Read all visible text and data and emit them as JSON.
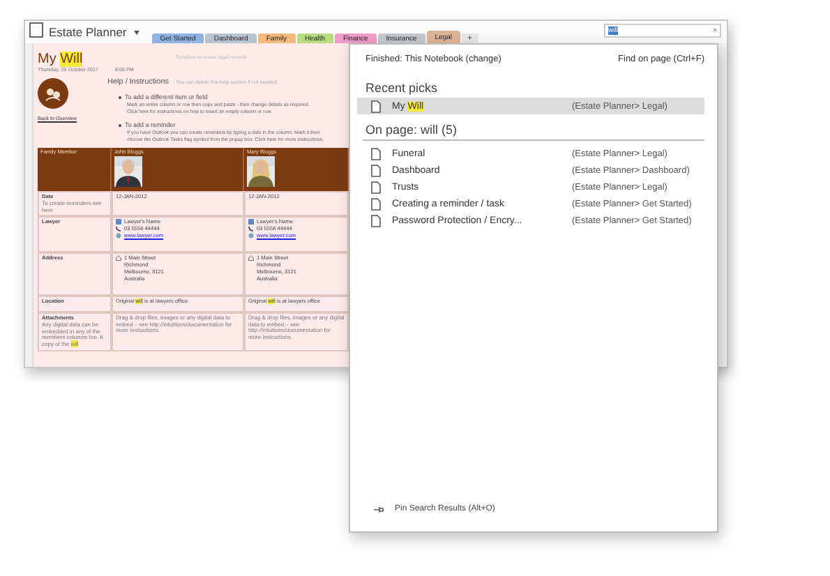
{
  "window": {
    "title": "Estate Planner",
    "tabs": [
      {
        "label": "Get Started",
        "color": "#8fb4e3",
        "selected": false
      },
      {
        "label": "Dashboard",
        "color": "#b8c4d0",
        "selected": false
      },
      {
        "label": "Family",
        "color": "#f5b979",
        "selected": false
      },
      {
        "label": "Health",
        "color": "#b5dc7e",
        "selected": false
      },
      {
        "label": "Finance",
        "color": "#f29ac8",
        "selected": false
      },
      {
        "label": "Insurance",
        "color": "#c3c8ce",
        "selected": false
      },
      {
        "label": "Legal",
        "color": "#dcb49a",
        "selected": true
      }
    ],
    "add_tab": "+"
  },
  "search": {
    "value": "will",
    "clear": "×"
  },
  "page": {
    "title": [
      {
        "text": "My "
      },
      {
        "text": "Will",
        "match": true
      }
    ],
    "date": "Thursday, 26 October 2017",
    "time": "8:05 PM",
    "note": "Template to create legal records",
    "back_link": "Back to Overview",
    "help": {
      "title": "Help / Instructions",
      "note": "- You can delete this help section if not needed",
      "items": [
        {
          "heading": "To add a different item or field",
          "lines": [
            "Mark an entire column or row then copy and paste - then change details as required.",
            "Click here for instructions on how to insert an empty column or row."
          ]
        },
        {
          "heading": "To add a reminder",
          "lines": [
            "If you have Outlook you can create reminders by typing a date in the column. Mark it then",
            "choose the Outlook Tasks flag symbol from the popup box. Click here for more instructions."
          ]
        }
      ]
    },
    "table": {
      "columns": [
        "Family Member",
        "John Bloggs",
        "Mary Bloggs"
      ],
      "rows": [
        {
          "kind": "text",
          "cells": [
            {
              "label": "Date",
              "sub": [
                {
                  "text": "To create reminders see here"
                }
              ]
            },
            {
              "lines": [
                [
                  {
                    "text": "12-JAN-2012"
                  }
                ]
              ]
            },
            {
              "lines": [
                [
                  {
                    "text": "12-JAN-2012"
                  }
                ]
              ]
            }
          ]
        },
        {
          "kind": "contact",
          "cells": [
            {
              "label": "Lawyer"
            },
            {
              "lines": [
                [
                  {
                    "text": "Lawyer's Name"
                  }
                ],
                [
                  {
                    "text": "03 5556 44444"
                  }
                ],
                [
                  {
                    "text": "www.lawyer.com"
                  }
                ]
              ]
            },
            {
              "lines": [
                [
                  {
                    "text": "Lawyer's Name"
                  }
                ],
                [
                  {
                    "text": "03 5556 44444"
                  }
                ],
                [
                  {
                    "text": "www.lawyer.com"
                  }
                ]
              ]
            }
          ]
        },
        {
          "kind": "address",
          "cells": [
            {
              "label": "Address"
            },
            {
              "lines": [
                [
                  {
                    "text": "1 Main Street"
                  }
                ],
                [
                  {
                    "text": "Richmond"
                  }
                ],
                [
                  {
                    "text": "Melbourne, 3121"
                  }
                ],
                [
                  {
                    "text": "Australia"
                  }
                ]
              ]
            },
            {
              "lines": [
                [
                  {
                    "text": "1 Main Street"
                  }
                ],
                [
                  {
                    "text": "Richmond"
                  }
                ],
                [
                  {
                    "text": "Melbourne, 3121"
                  }
                ],
                [
                  {
                    "text": "Australia"
                  }
                ]
              ]
            }
          ]
        },
        {
          "kind": "text",
          "cells": [
            {
              "label": "Location"
            },
            {
              "lines": [
                [
                  {
                    "text": "Original "
                  },
                  {
                    "text": "will",
                    "match": true
                  },
                  {
                    "text": " is at lawyers office"
                  }
                ]
              ]
            },
            {
              "lines": [
                [
                  {
                    "text": "Original "
                  },
                  {
                    "text": "will",
                    "match": true
                  },
                  {
                    "text": " is at lawyers office"
                  }
                ]
              ]
            }
          ]
        },
        {
          "kind": "note",
          "cells": [
            {
              "label": "Attachments",
              "sub": [
                {
                  "text": "Any digital data can be embedded in any of the members columns too. A copy of the "
                },
                {
                  "text": "will",
                  "match": true
                }
              ]
            },
            {
              "lines": [
                [
                  {
                    "text": "Drag & drop files, images or any digital data to embed – see http://intuitions/documentation for more instructions."
                  }
                ]
              ]
            },
            {
              "lines": [
                [
                  {
                    "text": "Drag & drop files, images or any digital data to embed – see http://intuitions/documentation for more instructions."
                  }
                ]
              ]
            }
          ]
        }
      ]
    }
  },
  "results": {
    "scope": "Finished:  This Notebook (change)",
    "find_on_page": "Find on page (Ctrl+F)",
    "recent_heading": "Recent picks",
    "recent": [
      {
        "title": [
          {
            "text": "My "
          },
          {
            "text": "Will",
            "match": true
          }
        ],
        "location": "(Estate Planner> Legal)",
        "selected": true
      }
    ],
    "on_page_heading": "On page:  will (5)",
    "on_page": [
      {
        "title": [
          {
            "text": "Funeral"
          }
        ],
        "location": "(Estate Planner> Legal)",
        "selected": false
      },
      {
        "title": [
          {
            "text": "Dashboard"
          }
        ],
        "location": "(Estate Planner> Dashboard)",
        "selected": false
      },
      {
        "title": [
          {
            "text": "Trusts"
          }
        ],
        "location": "(Estate Planner> Legal)",
        "selected": false
      },
      {
        "title": [
          {
            "text": "Creating a reminder / task"
          }
        ],
        "location": "(Estate Planner> Get Started)",
        "selected": false
      },
      {
        "title": [
          {
            "text": "Password Protection / Encry..."
          }
        ],
        "location": "(Estate Planner> Get Started)",
        "selected": false
      }
    ],
    "pin": "Pin Search Results (Alt+O)"
  }
}
